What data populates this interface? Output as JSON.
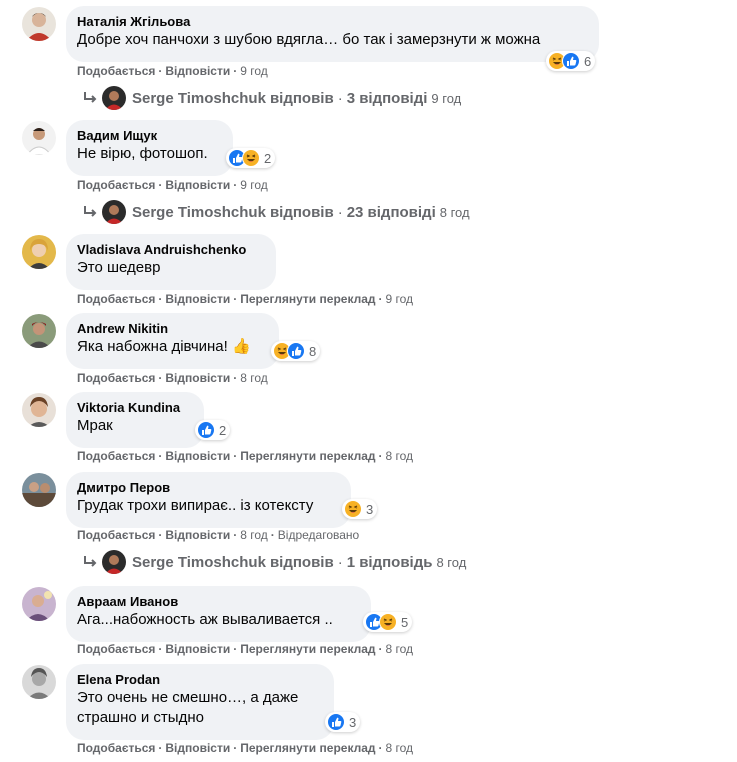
{
  "comments": [
    {
      "author": "Наталія Жгільова",
      "text": "Добре хоч панчохи з шубою вдягла… бо так і замерзнути ж можна",
      "reactions": {
        "icons": [
          "haha-icon",
          "like-icon"
        ],
        "count": "6"
      },
      "actions": {
        "like": "Подобається",
        "reply": "Відповісти",
        "time": "9 год"
      },
      "avatar_color": "#c0392b",
      "replies": {
        "name": "Serge Timoshchuk",
        "verb": "відповів",
        "count": "3 відповіді",
        "time": "9 год"
      }
    },
    {
      "author": "Вадим Ищук",
      "text": "Не вірю, фотошоп.",
      "reactions": {
        "icons": [
          "like-icon",
          "haha-icon"
        ],
        "count": "2"
      },
      "actions": {
        "like": "Подобається",
        "reply": "Відповісти",
        "time": "9 год"
      },
      "avatar_color": "#dcdcdc",
      "replies": {
        "name": "Serge Timoshchuk",
        "verb": "відповів",
        "count": "23 відповіді",
        "time": "8 год"
      }
    },
    {
      "author": "Vladislava Andruishchenko",
      "text": "Это шедевр",
      "actions": {
        "like": "Подобається",
        "reply": "Відповісти",
        "translate": "Переглянути переклад",
        "time": "9 год"
      },
      "avatar_color": "#e3b84a"
    },
    {
      "author": "Andrew Nikitin",
      "text": "Яка набожна дівчина! 👍",
      "reactions": {
        "icons": [
          "haha-icon",
          "like-icon"
        ],
        "count": "8"
      },
      "actions": {
        "like": "Подобається",
        "reply": "Відповісти",
        "time": "8 год"
      },
      "avatar_color": "#6b7a56"
    },
    {
      "author": "Viktoria Kundina",
      "text": "Мрак",
      "reactions": {
        "icons": [
          "like-icon"
        ],
        "count": "2"
      },
      "actions": {
        "like": "Подобається",
        "reply": "Відповісти",
        "translate": "Переглянути переклад",
        "time": "8 год"
      },
      "avatar_color": "#d6a985"
    },
    {
      "author": "Дмитро Перов",
      "text": "Грудак трохи випирає.. із котексту",
      "reactions": {
        "icons": [
          "haha-icon"
        ],
        "count": "3"
      },
      "actions": {
        "like": "Подобається",
        "reply": "Відповісти",
        "time": "8 год",
        "edited": "Відредаговано"
      },
      "avatar_color": "#7b5a4a",
      "replies": {
        "name": "Serge Timoshchuk",
        "verb": "відповів",
        "count": "1 відповідь",
        "time": "8 год"
      }
    },
    {
      "author": "Авраам Иванов",
      "text": "Ага...набожность аж вываливается ..",
      "reactions": {
        "icons": [
          "like-icon",
          "haha-icon"
        ],
        "count": "5"
      },
      "actions": {
        "like": "Подобається",
        "reply": "Відповісти",
        "translate": "Переглянути переклад",
        "time": "8 год"
      },
      "avatar_color": "#8e6f9c"
    },
    {
      "author": "Elena Prodan",
      "text": "Это очень не смешно…, а даже\nстрашно и стыдно",
      "reactions": {
        "icons": [
          "like-icon"
        ],
        "count": "3"
      },
      "actions": {
        "like": "Подобається",
        "reply": "Відповісти",
        "translate": "Переглянути переклад",
        "time": "8 год"
      },
      "avatar_color": "#bdbdbd"
    }
  ],
  "colors": {
    "like": "#1877f2",
    "haha": "#f7b125",
    "bubble": "#f0f2f5",
    "meta": "#65676b"
  }
}
